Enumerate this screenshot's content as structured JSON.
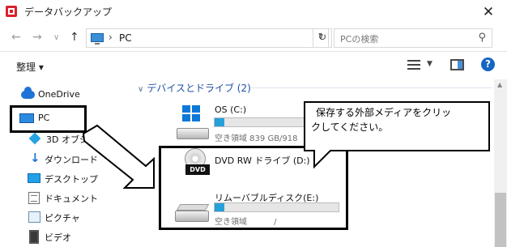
{
  "window": {
    "title": "データバックアップ",
    "close_glyph": "✕"
  },
  "toolbar": {
    "back_glyph": "←",
    "forward_glyph": "→",
    "recent_glyph": "∨",
    "up_glyph": "↑",
    "address_separator": "›",
    "address_path": "PC",
    "address_dropdown_glyph": "∨",
    "refresh_glyph": "↻",
    "search_placeholder": "PCの検索",
    "search_glyph": "⚲"
  },
  "command_bar": {
    "organize_label": "整理 ▾",
    "view_dropdown_glyph": "▼",
    "help_glyph": "?"
  },
  "navigation": {
    "items": [
      {
        "label": "OneDrive",
        "icon": "cloud-icon"
      },
      {
        "label": "PC",
        "icon": "pc-icon"
      },
      {
        "label": "3D オブジェ",
        "icon": "3d-objects-icon"
      },
      {
        "label": "ダウンロード",
        "icon": "download-icon"
      },
      {
        "label": "デスクトップ",
        "icon": "desktop-icon"
      },
      {
        "label": "ドキュメント",
        "icon": "documents-icon"
      },
      {
        "label": "ピクチャ",
        "icon": "pictures-icon"
      },
      {
        "label": "ビデオ",
        "icon": "videos-icon"
      }
    ]
  },
  "content": {
    "group_header": "デバイスとドライブ (2)",
    "group_chevron": "∨",
    "drives": [
      {
        "name": "OS (C:)",
        "space": "空き領域 839 GB/918",
        "usage": 0.09,
        "icon": "windows-drive-icon"
      },
      {
        "name": "DVD RW ドライブ (D:)",
        "icon": "dvd-drive-icon",
        "icon_label": "DVD"
      },
      {
        "name": "リムーバブルディスク(E:)",
        "space": "空き領域　　　 /",
        "usage": 0.08,
        "icon": "removable-drive-icon"
      }
    ]
  },
  "callout": {
    "line1": "保存する外部メディアをクリッ",
    "line2": "クしてください。"
  },
  "colors": {
    "accent": "#26a0da",
    "link_blue": "#1f4fa8",
    "annotation": "#000000"
  }
}
